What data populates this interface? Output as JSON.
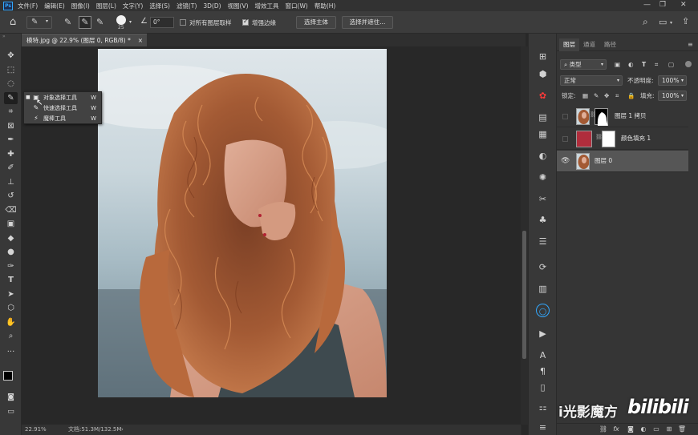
{
  "app": {
    "logo_text": "Ps"
  },
  "menu": [
    "文件(F)",
    "编辑(E)",
    "图像(I)",
    "图层(L)",
    "文字(Y)",
    "选择(S)",
    "滤镜(T)",
    "3D(D)",
    "视图(V)",
    "增效工具",
    "窗口(W)",
    "帮助(H)"
  ],
  "options": {
    "brush_size": "25",
    "angle": "0°",
    "sample_all_layers_label": "对所有图层取样",
    "sample_all_layers_checked": false,
    "enhance_edge_label": "增强边缘",
    "enhance_edge_checked": true,
    "select_subject_label": "选择主体",
    "select_and_mask_label": "选择并遮住..."
  },
  "document": {
    "tab_title": "模特.jpg @ 22.9% (图层 0, RGB/8) *",
    "zoom": "22.91%",
    "doc_size": "文档:51.3M/132.5M"
  },
  "flyout": {
    "items": [
      {
        "label": "对象选择工具",
        "shortcut": "W",
        "icon": "object-selection-icon",
        "selected": true
      },
      {
        "label": "快速选择工具",
        "shortcut": "W",
        "icon": "quick-selection-icon",
        "selected": false
      },
      {
        "label": "魔棒工具",
        "shortcut": "W",
        "icon": "magic-wand-icon",
        "selected": false
      }
    ]
  },
  "layers_panel": {
    "tabs": [
      "图层",
      "通道",
      "路径"
    ],
    "active_tab": "图层",
    "filter_kind": "类型",
    "blend_mode": "正常",
    "opacity_label": "不透明度:",
    "opacity": "100%",
    "lock_label": "锁定:",
    "fill_label": "填充:",
    "fill": "100%",
    "layers": [
      {
        "name": "图层 1 拷贝",
        "visible": false,
        "has_mask": true,
        "active": false
      },
      {
        "name": "颜色填充 1",
        "visible": false,
        "has_mask": true,
        "active": false,
        "fill_color": "#b02d3c"
      },
      {
        "name": "图层 0",
        "visible": true,
        "has_mask": false,
        "active": true
      }
    ]
  },
  "watermark": {
    "text1": "i光影魔方",
    "text2": "bilibili"
  },
  "colors": {
    "accent": "#31a8ff",
    "fill_layer_color": "#b02d3c"
  }
}
